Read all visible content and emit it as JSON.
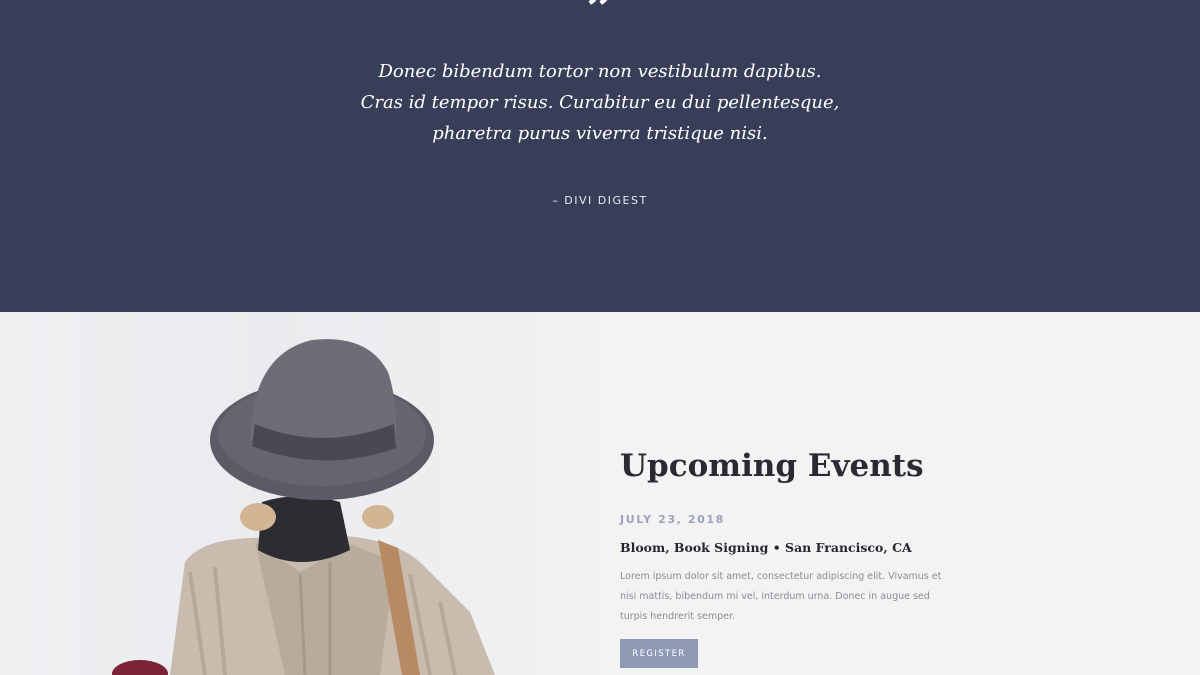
{
  "testimonial": {
    "quote_mark": "”",
    "lines": [
      "Donec bibendum tortor non vestibulum dapibus.",
      "Cras id tempor risus. Curabitur eu dui pellentesque,",
      "pharetra purus viverra tristique nisi."
    ],
    "author": "– DIVI DIGEST"
  },
  "events": {
    "title": "Upcoming Events",
    "items": [
      {
        "date": "JULY 23, 2018",
        "name": "Bloom, Book Signing • San Francisco, CA",
        "description": "Lorem ipsum dolor sit amet, consectetur adipiscing elit. Vivamus et nisi mattis, bibendum mi vel, interdum urna. Donec in augue sed turpis hendrerit semper.",
        "button_label": "REGISTER"
      }
    ]
  },
  "colors": {
    "banner_background": "#383e58",
    "button_background": "#8e9ab5",
    "date_text": "#9aa3b8"
  }
}
